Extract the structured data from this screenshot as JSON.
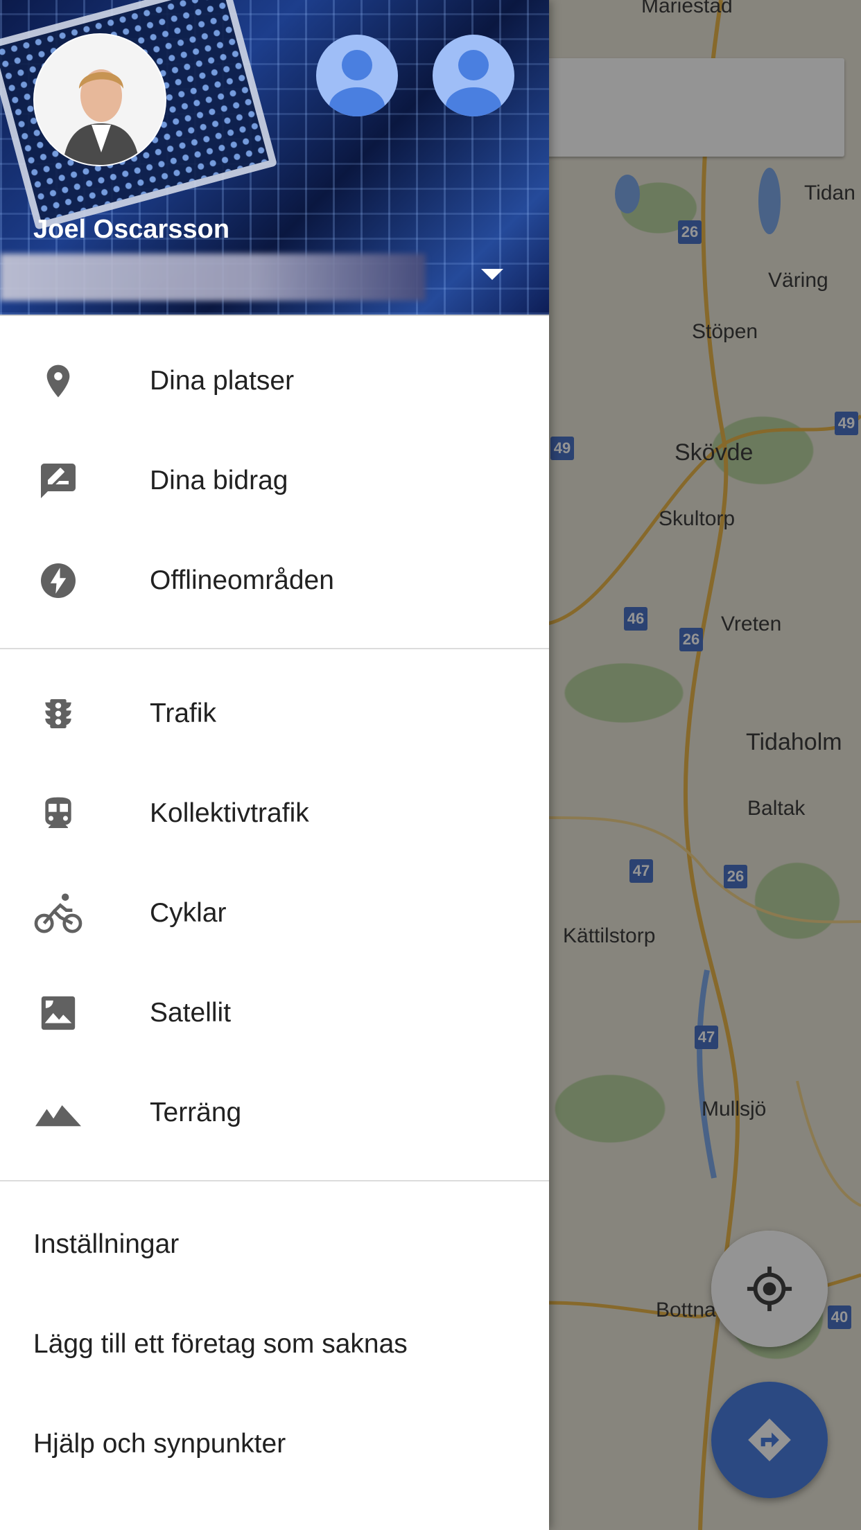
{
  "map": {
    "labels": [
      "Mariestad",
      "Tidan",
      "Väring",
      "Stöpen",
      "Skövde",
      "Skultorp",
      "Vreten",
      "Tidaholm",
      "Baltak",
      "Kättilstorp",
      "Mullsjö",
      "Bottna"
    ],
    "shields": [
      "26",
      "49",
      "49",
      "46",
      "26",
      "47",
      "26",
      "47",
      "40"
    ]
  },
  "drawer": {
    "user_name": "Joel Oscarsson",
    "section1": [
      {
        "label": "Dina platser",
        "icon": "place-pin-icon"
      },
      {
        "label": "Dina bidrag",
        "icon": "rate-review-icon"
      },
      {
        "label": "Offlineområden",
        "icon": "offline-bolt-icon"
      }
    ],
    "section2": [
      {
        "label": "Trafik",
        "icon": "traffic-light-icon"
      },
      {
        "label": "Kollektivtrafik",
        "icon": "train-icon"
      },
      {
        "label": "Cyklar",
        "icon": "bicycle-icon"
      },
      {
        "label": "Satellit",
        "icon": "satellite-icon"
      },
      {
        "label": "Terräng",
        "icon": "terrain-icon"
      }
    ],
    "footer": {
      "settings": "Inställningar",
      "add_business": "Lägg till ett företag som saknas",
      "help": "Hjälp och synpunkter"
    }
  },
  "colors": {
    "accent": "#4a7fe0",
    "shield": "#4a72c4",
    "icon": "#616161"
  }
}
